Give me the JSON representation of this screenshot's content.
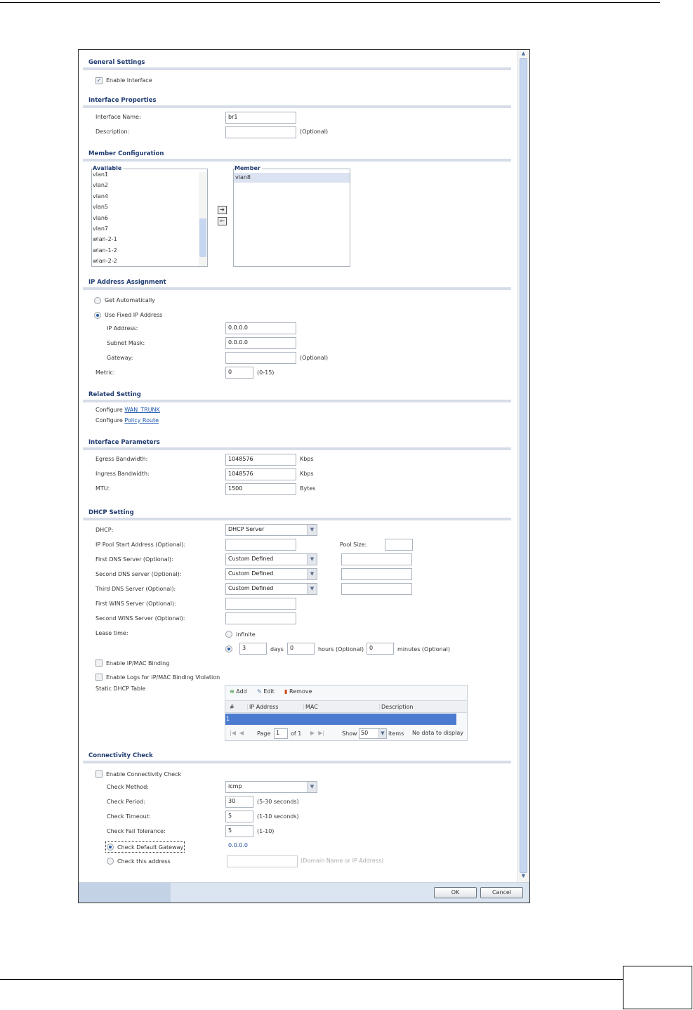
{
  "general": {
    "title": "General Settings",
    "enable_interface": "Enable Interface"
  },
  "props": {
    "title": "Interface Properties",
    "name_label": "Interface Name:",
    "name_value": "br1",
    "desc_label": "Description:",
    "optional": "(Optional)"
  },
  "member": {
    "title": "Member Configuration",
    "available_label": "Available",
    "member_label": "Member",
    "available": [
      "vlan1",
      "vlan2",
      "vlan4",
      "vlan5",
      "vlan6",
      "vlan7",
      "wlan-2-1",
      "wlan-1-2",
      "wlan-2-2"
    ],
    "members": [
      "vlan8"
    ]
  },
  "ip": {
    "title": "IP Address Assignment",
    "get_auto": "Get Automatically",
    "use_fixed": "Use Fixed IP Address",
    "ip_label": "IP Address:",
    "ip_value": "0.0.0.0",
    "mask_label": "Subnet Mask:",
    "mask_value": "0.0.0.0",
    "gw_label": "Gateway:",
    "optional": "(Optional)",
    "metric_label": "Metric:",
    "metric_value": "0",
    "metric_range": "(0-15)"
  },
  "related": {
    "title": "Related Setting",
    "configure1": "Configure",
    "link1": "WAN_TRUNK",
    "configure2": "Configure",
    "link2": "Policy Route"
  },
  "params": {
    "title": "Interface Parameters",
    "egress_label": "Egress Bandwidth:",
    "egress_value": "1048576",
    "ingress_label": "Ingress Bandwidth:",
    "ingress_value": "1048576",
    "kbps": "Kbps",
    "mtu_label": "MTU:",
    "mtu_value": "1500",
    "bytes": "Bytes"
  },
  "dhcp": {
    "title": "DHCP Setting",
    "dhcp_label": "DHCP:",
    "dhcp_value": "DHCP Server",
    "pool_label": "IP Pool Start Address (Optional):",
    "pool_size_label": "Pool Size:",
    "dns1_label": "First DNS Server (Optional):",
    "dns2_label": "Second DNS server (Optional):",
    "dns3_label": "Third DNS Server (Optional):",
    "dns_value": "Custom Defined",
    "wins1_label": "First WINS Server (Optional):",
    "wins2_label": "Second WINS Server (Optional):",
    "lease_label": "Lease time:",
    "infinite": "infinite",
    "days_value": "3",
    "days": "days",
    "hours_value": "0",
    "hours": "hours (Optional)",
    "minutes_value": "0",
    "minutes": "minutes (Optional)",
    "ipmac": "Enable IP/MAC Binding",
    "ipmac_logs": "Enable Logs for IP/MAC Binding Violation",
    "static_label": "Static DHCP Table",
    "table": {
      "add": "Add",
      "edit": "Edit",
      "remove": "Remove",
      "columns": [
        "#",
        "IP Address",
        "MAC",
        "Description"
      ],
      "row_num": "1",
      "page": "Page",
      "page_value": "1",
      "of": "of 1",
      "show": "Show",
      "show_value": "50",
      "items": "items",
      "no_data": "No data to display"
    }
  },
  "conn": {
    "title": "Connectivity Check",
    "enable": "Enable Connectivity Check",
    "method_label": "Check Method:",
    "method_value": "icmp",
    "period_label": "Check Period:",
    "period_value": "30",
    "period_range": "(5-30 seconds)",
    "timeout_label": "Check Timeout:",
    "timeout_value": "5",
    "timeout_range": "(1-10 seconds)",
    "fail_label": "Check Fail Tolerance:",
    "fail_value": "5",
    "fail_range": "(1-10)",
    "default_gw": "Check Default Gateway",
    "default_gw_value": "0.0.0.0",
    "this_addr": "Check this address",
    "addr_hint": "(Domain Name or IP Address)"
  },
  "footer": {
    "ok": "OK",
    "cancel": "Cancel"
  }
}
